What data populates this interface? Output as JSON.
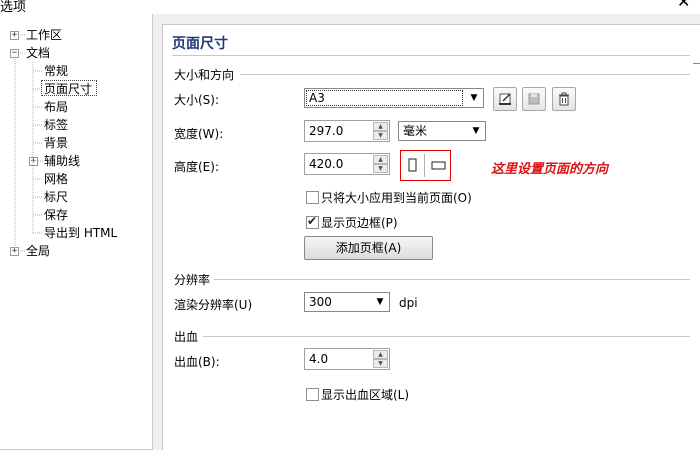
{
  "window": {
    "title": "选项",
    "close_glyph": "✕"
  },
  "tree": {
    "items": [
      {
        "label": "工作区",
        "expander": "+"
      },
      {
        "label": "文档",
        "expander": "−"
      },
      {
        "label": "常规"
      },
      {
        "label": "页面尺寸"
      },
      {
        "label": "布局"
      },
      {
        "label": "标签"
      },
      {
        "label": "背景"
      },
      {
        "label": "辅助线",
        "expander": "+"
      },
      {
        "label": "网格"
      },
      {
        "label": "标尺"
      },
      {
        "label": "保存"
      },
      {
        "label": "导出到 HTML"
      },
      {
        "label": "全局",
        "expander": "+"
      }
    ],
    "selected": "页面尺寸"
  },
  "page": {
    "title": "页面尺寸",
    "size_section": {
      "heading": "大小和方向",
      "size_label": "大小(S):",
      "size_value": "A3",
      "width_label": "宽度(W):",
      "width_value": "297.0",
      "unit_value": "毫米",
      "height_label": "高度(E):",
      "height_value": "420.0",
      "apply_current_label": "只将大小应用到当前页面(O)",
      "apply_current_checked": false,
      "show_border_label": "显示页边框(P)",
      "show_border_checked": true,
      "add_frame_label": "添加页框(A)"
    },
    "resolution_section": {
      "heading": "分辨率",
      "render_label": "渲染分辨率(U)",
      "render_value": "300",
      "render_unit": "dpi"
    },
    "bleed_section": {
      "heading": "出血",
      "bleed_label": "出血(B):",
      "bleed_value": "4.0",
      "show_bleed_label": "显示出血区域(L)",
      "show_bleed_checked": false
    }
  },
  "annotation": {
    "text": "这里设置页面的方向",
    "color": "#d11111"
  },
  "icons": {
    "save_preset": "save-preset-icon",
    "disk": "disk-icon",
    "trash": "trash-icon",
    "portrait": "portrait-icon",
    "landscape": "landscape-icon",
    "dropdown": "chevron-down-icon",
    "spin_up": "spin-up-icon",
    "spin_down": "spin-down-icon",
    "checkmark": "checkmark-icon"
  },
  "colors": {
    "accent_title": "#1e3a78",
    "highlight_box": "#e00000"
  }
}
